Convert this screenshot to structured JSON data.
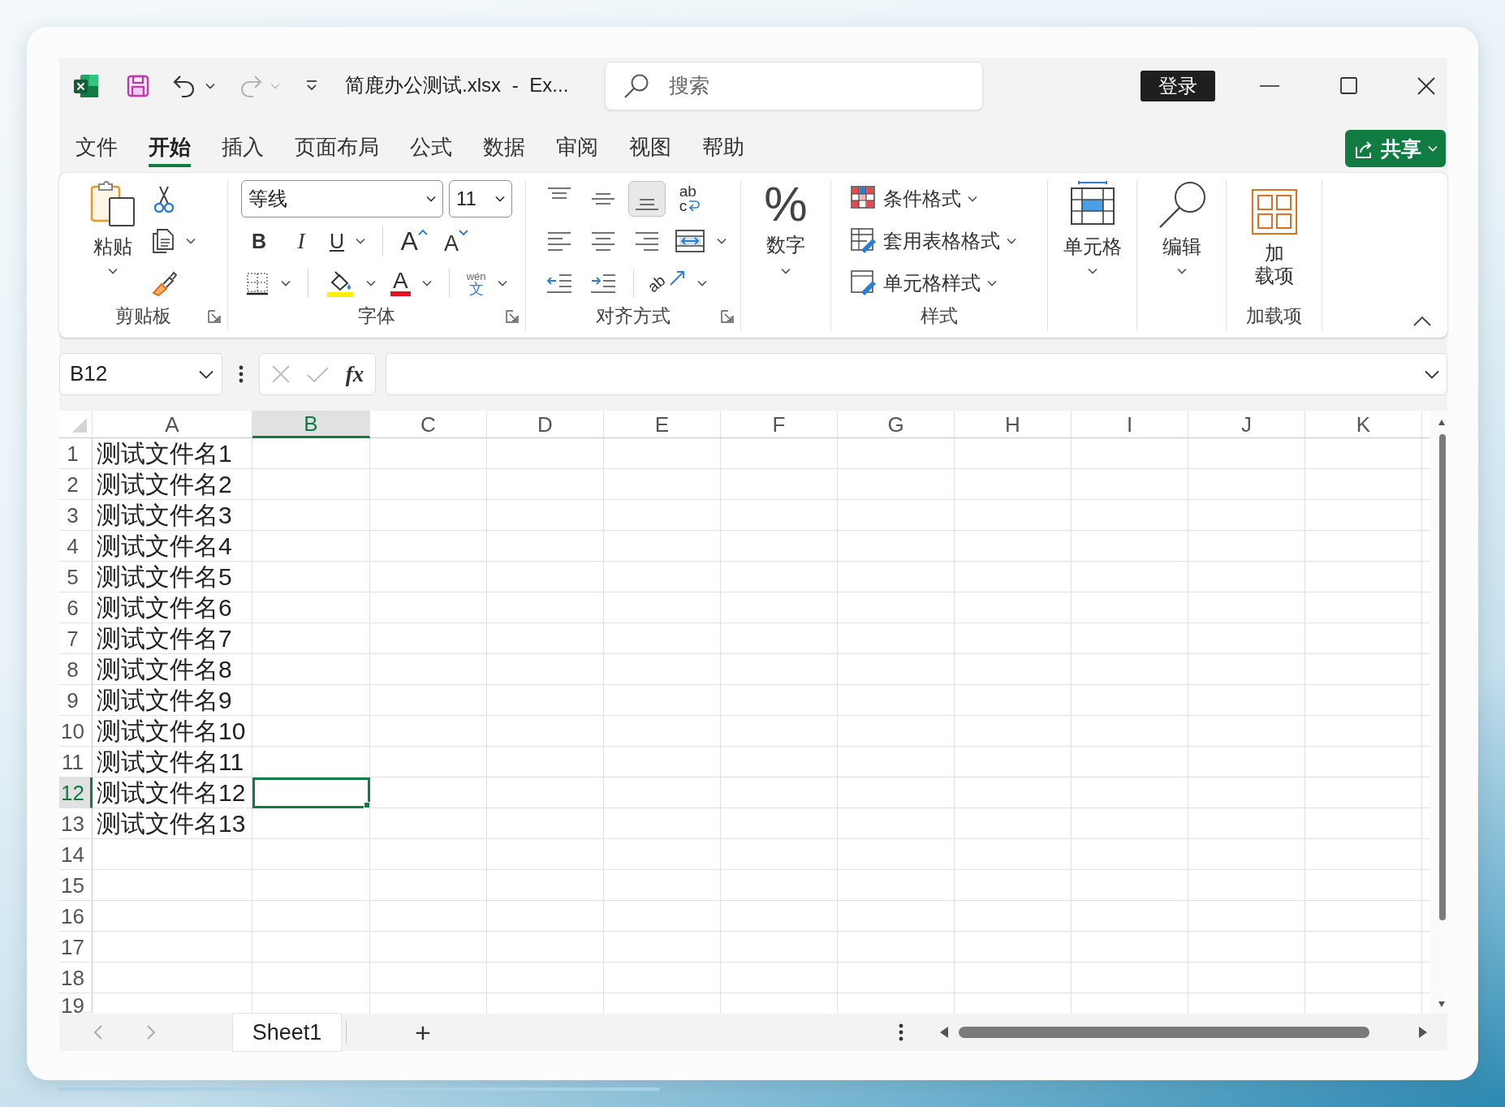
{
  "window": {
    "title": "简鹿办公测试.xlsx - Ex...",
    "search_placeholder": "搜索",
    "sign_in": "登录"
  },
  "quick_access": [
    {
      "kind": "save",
      "disabled": false,
      "dropdown": false
    },
    {
      "kind": "undo",
      "disabled": false,
      "dropdown": true
    },
    {
      "kind": "redo",
      "disabled": true,
      "dropdown": true
    },
    {
      "kind": "customize",
      "disabled": false,
      "dropdown": false
    }
  ],
  "ribbon_tabs": [
    {
      "label": "文件",
      "selected": false
    },
    {
      "label": "开始",
      "selected": true
    },
    {
      "label": "插入",
      "selected": false
    },
    {
      "label": "页面布局",
      "selected": false
    },
    {
      "label": "公式",
      "selected": false
    },
    {
      "label": "数据",
      "selected": false
    },
    {
      "label": "审阅",
      "selected": false
    },
    {
      "label": "视图",
      "selected": false
    },
    {
      "label": "帮助",
      "selected": false
    }
  ],
  "share_button": {
    "label": "共享",
    "dropdown": true
  },
  "ribbon_groups": [
    {
      "kind": "clipboard",
      "label": "剪贴板",
      "launcher": true,
      "paste": {
        "label": "粘贴",
        "dropdown": true
      },
      "tools": [
        {
          "kind": "cut",
          "dropdown": false
        },
        {
          "kind": "copy",
          "dropdown": true
        },
        {
          "kind": "painter",
          "dropdown": false
        }
      ]
    },
    {
      "kind": "font",
      "label": "字体",
      "launcher": true,
      "font_name": "等线",
      "font_size": "11",
      "rows": [
        [
          {
            "kind": "bold",
            "text": "B",
            "dropdown": false
          },
          {
            "kind": "italic",
            "text": "I",
            "dropdown": false
          },
          {
            "kind": "underline",
            "text": "U",
            "dropdown": true
          },
          {
            "kind": "separator"
          },
          {
            "kind": "grow",
            "text": "A",
            "dropdown": false
          },
          {
            "kind": "shrink",
            "text": "A",
            "dropdown": false
          }
        ],
        [
          {
            "kind": "borders",
            "dropdown": true
          },
          {
            "kind": "separator"
          },
          {
            "kind": "fill",
            "dropdown": true
          },
          {
            "kind": "font_color",
            "text": "A",
            "dropdown": true
          },
          {
            "kind": "separator"
          },
          {
            "kind": "phonetic",
            "text": "wén",
            "subtext": "文",
            "dropdown": true
          }
        ]
      ]
    },
    {
      "kind": "alignment",
      "label": "对齐方式",
      "launcher": true,
      "rows": [
        [
          {
            "kind": "align_top",
            "selected": false,
            "dropdown": false
          },
          {
            "kind": "align_middle",
            "selected": false,
            "dropdown": false
          },
          {
            "kind": "align_bottom",
            "selected": true,
            "dropdown": false
          },
          {
            "kind": "wrap",
            "text": "ab",
            "subtext": "c",
            "selected": false,
            "dropdown": false
          }
        ],
        [
          {
            "kind": "align_left",
            "selected": false,
            "dropdown": false
          },
          {
            "kind": "align_center",
            "selected": false,
            "dropdown": false
          },
          {
            "kind": "align_right",
            "selected": false,
            "dropdown": false
          },
          {
            "kind": "merge",
            "selected": false,
            "dropdown": true
          }
        ],
        [
          {
            "kind": "indent_less",
            "selected": false,
            "dropdown": false
          },
          {
            "kind": "indent_more",
            "selected": false,
            "dropdown": false
          },
          {
            "kind": "separator"
          },
          {
            "kind": "orientation",
            "text": "ab",
            "selected": false,
            "dropdown": true
          }
        ]
      ]
    },
    {
      "kind": "number",
      "symbol": "%",
      "button": "数字",
      "dropdown": true
    },
    {
      "kind": "styles",
      "label": "样式",
      "items": [
        {
          "kind": "conditional",
          "label": "条件格式",
          "dropdown": true
        },
        {
          "kind": "table",
          "label": "套用表格格式",
          "dropdown": true
        },
        {
          "kind": "cell_style",
          "label": "单元格样式",
          "dropdown": true
        }
      ]
    },
    {
      "kind": "cells",
      "button": "单元格",
      "dropdown": true
    },
    {
      "kind": "editing",
      "button": "编辑",
      "dropdown": true
    },
    {
      "kind": "addins",
      "label": "加载项",
      "button_lines": [
        "加",
        "载项"
      ],
      "dropdown": false
    }
  ],
  "formula_bar": {
    "name_box": "B12",
    "buttons": [
      {
        "kind": "cancel",
        "disabled": true
      },
      {
        "kind": "enter",
        "disabled": true
      },
      {
        "kind": "function",
        "text": "fx",
        "disabled": false
      }
    ]
  },
  "sheet": {
    "columns": [
      {
        "label": "A",
        "selected": false
      },
      {
        "label": "B",
        "selected": true
      },
      {
        "label": "C",
        "selected": false
      },
      {
        "label": "D",
        "selected": false
      },
      {
        "label": "E",
        "selected": false
      },
      {
        "label": "F",
        "selected": false
      },
      {
        "label": "G",
        "selected": false
      },
      {
        "label": "H",
        "selected": false
      },
      {
        "label": "I",
        "selected": false
      },
      {
        "label": "J",
        "selected": false
      },
      {
        "label": "K",
        "selected": false
      }
    ],
    "rows": [
      {
        "label": "1",
        "selected": false,
        "cells": [
          "测试文件名1"
        ]
      },
      {
        "label": "2",
        "selected": false,
        "cells": [
          "测试文件名2"
        ]
      },
      {
        "label": "3",
        "selected": false,
        "cells": [
          "测试文件名3"
        ]
      },
      {
        "label": "4",
        "selected": false,
        "cells": [
          "测试文件名4"
        ]
      },
      {
        "label": "5",
        "selected": false,
        "cells": [
          "测试文件名5"
        ]
      },
      {
        "label": "6",
        "selected": false,
        "cells": [
          "测试文件名6"
        ]
      },
      {
        "label": "7",
        "selected": false,
        "cells": [
          "测试文件名7"
        ]
      },
      {
        "label": "8",
        "selected": false,
        "cells": [
          "测试文件名8"
        ]
      },
      {
        "label": "9",
        "selected": false,
        "cells": [
          "测试文件名9"
        ]
      },
      {
        "label": "10",
        "selected": false,
        "cells": [
          "测试文件名10"
        ]
      },
      {
        "label": "11",
        "selected": false,
        "cells": [
          "测试文件名11"
        ]
      },
      {
        "label": "12",
        "selected": true,
        "cells": [
          "测试文件名12"
        ]
      },
      {
        "label": "13",
        "selected": false,
        "cells": [
          "测试文件名13"
        ]
      },
      {
        "label": "14",
        "selected": false
      },
      {
        "label": "15",
        "selected": false
      },
      {
        "label": "16",
        "selected": false
      },
      {
        "label": "17",
        "selected": false
      },
      {
        "label": "18",
        "selected": false
      },
      {
        "label": "19",
        "selected": false
      }
    ]
  },
  "sheet_tabs": [
    {
      "label": "Sheet1",
      "selected": true
    }
  ],
  "add_sheet": "+"
}
